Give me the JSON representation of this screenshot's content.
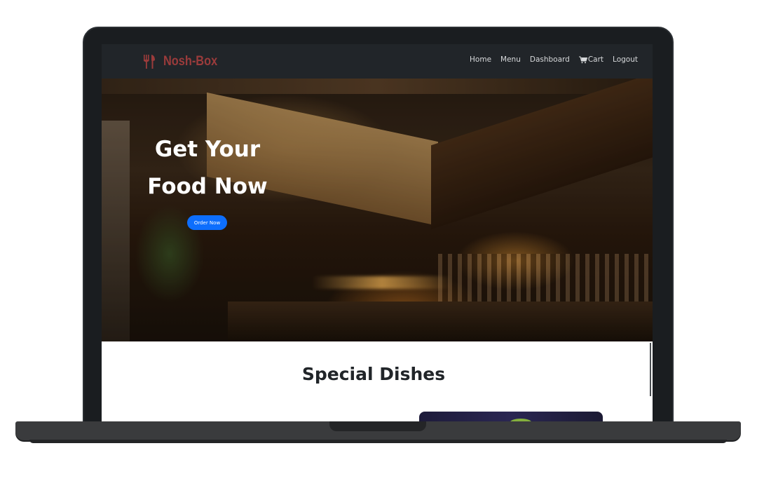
{
  "brand": {
    "name": "Nosh-Box",
    "icon": "fork-knife-icon",
    "color": "#9a3b3b"
  },
  "nav": {
    "items": [
      {
        "label": "Home"
      },
      {
        "label": "Menu"
      },
      {
        "label": "Dashboard"
      },
      {
        "label": "Cart",
        "icon": "cart-icon"
      },
      {
        "label": "Logout"
      }
    ]
  },
  "hero": {
    "title_line1": "Get Your",
    "title_line2": "Food Now",
    "cta_label": "Order Now",
    "cta_color": "#0d6efd"
  },
  "special": {
    "title": "Special Dishes"
  }
}
